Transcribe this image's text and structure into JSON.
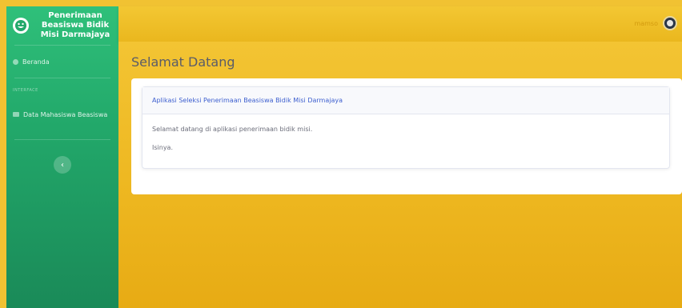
{
  "sidebar": {
    "brand": "Penerimaan Beasiswa Bidik Misi Darmajaya",
    "items": [
      {
        "label": "Beranda",
        "icon": "home-icon"
      },
      {
        "label": "Data Mahasiswa Beasiswa",
        "icon": "table-icon"
      }
    ],
    "heading": "INTERFACE",
    "toggle_icon": "chevron-left-icon"
  },
  "topbar": {
    "user_name": "mamso"
  },
  "main": {
    "title": "Selamat Datang",
    "card": {
      "header": "Aplikasi Seleksi Penerimaan Beasiswa Bidik Misi Darmajaya",
      "line1": "Selamat datang di aplikasi penerimaan bidik misi.",
      "line2": "Isinya."
    }
  },
  "colors": {
    "sidebar_top": "#2fc07a",
    "sidebar_bottom": "#1a8a58",
    "content_bg": "#f1c232",
    "card_header_text": "#3d5fcf"
  }
}
